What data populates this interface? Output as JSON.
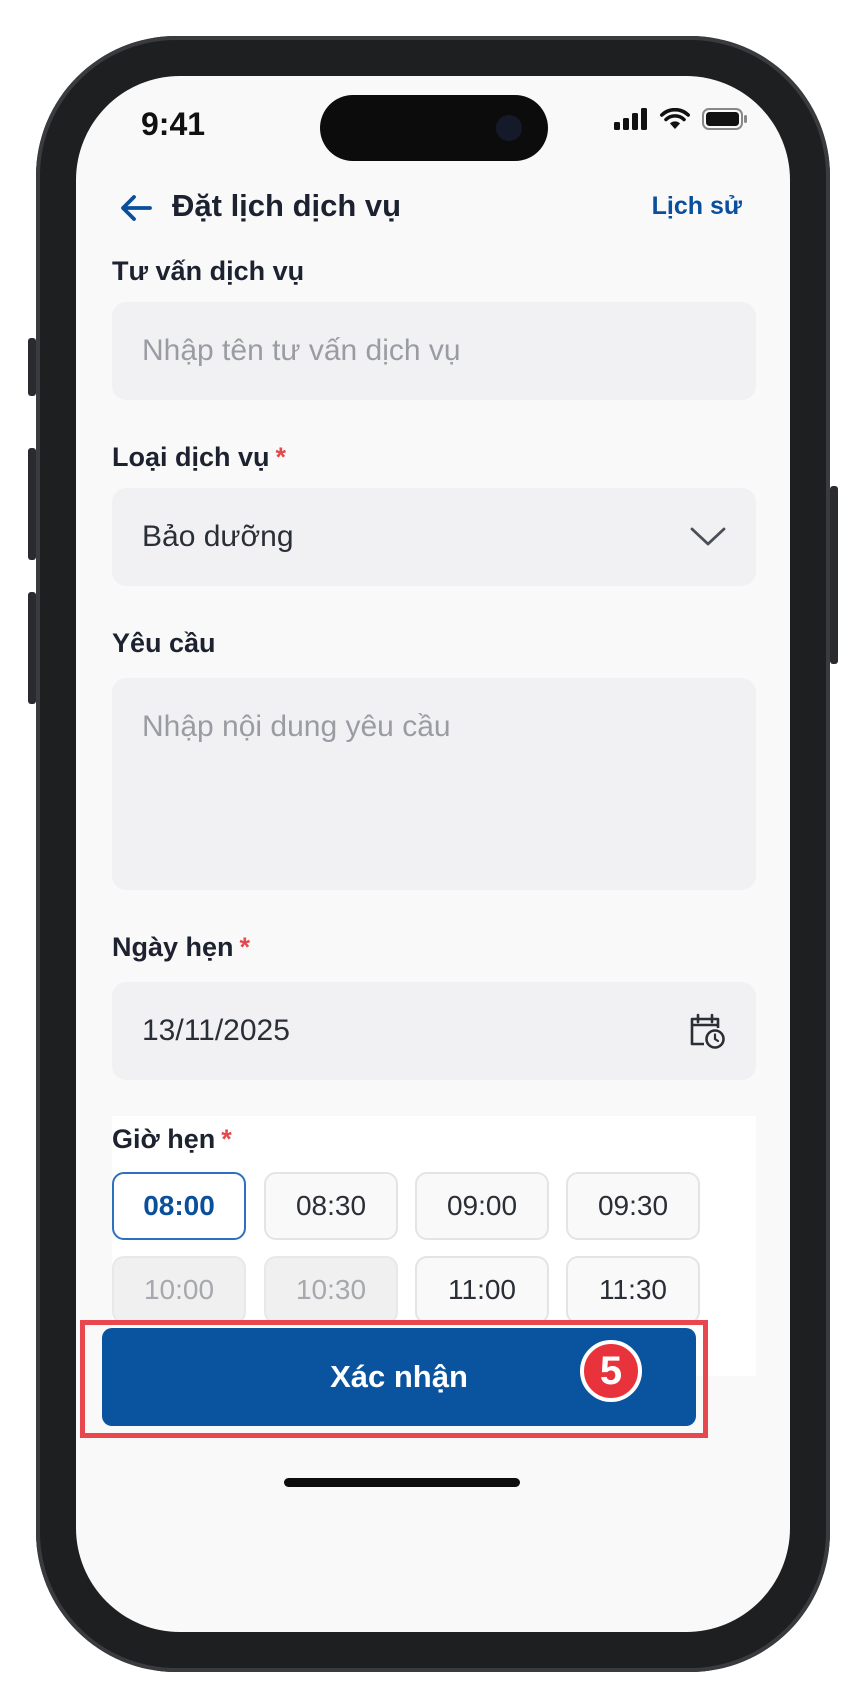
{
  "status_bar": {
    "time": "9:41"
  },
  "header": {
    "title": "Đặt lịch dịch vụ",
    "history_link": "Lịch sử"
  },
  "form": {
    "consult": {
      "label": "Tư vấn dịch vụ",
      "placeholder": "Nhập tên tư vấn dịch vụ"
    },
    "service_type": {
      "label": "Loại dịch vụ",
      "required_mark": "*",
      "value": "Bảo dưỡng"
    },
    "request": {
      "label": "Yêu cầu",
      "placeholder": "Nhập nội dung yêu cầu"
    },
    "date": {
      "label": "Ngày hẹn",
      "required_mark": "*",
      "value": "13/11/2025"
    },
    "time": {
      "label": "Giờ hẹn",
      "required_mark": "*",
      "slots": [
        {
          "label": "08:00",
          "state": "selected"
        },
        {
          "label": "08:30",
          "state": "available"
        },
        {
          "label": "09:00",
          "state": "available"
        },
        {
          "label": "09:30",
          "state": "available"
        },
        {
          "label": "10:00",
          "state": "disabled"
        },
        {
          "label": "10:30",
          "state": "disabled"
        },
        {
          "label": "11:00",
          "state": "available"
        },
        {
          "label": "11:30",
          "state": "available"
        }
      ]
    }
  },
  "confirm_button": {
    "label": "Xác nhận"
  },
  "annotation": {
    "step": "5"
  },
  "colors": {
    "primary": "#0a539f",
    "accent_text": "#0a4f9c",
    "required": "#e5484d",
    "highlight": "#e8474e"
  }
}
